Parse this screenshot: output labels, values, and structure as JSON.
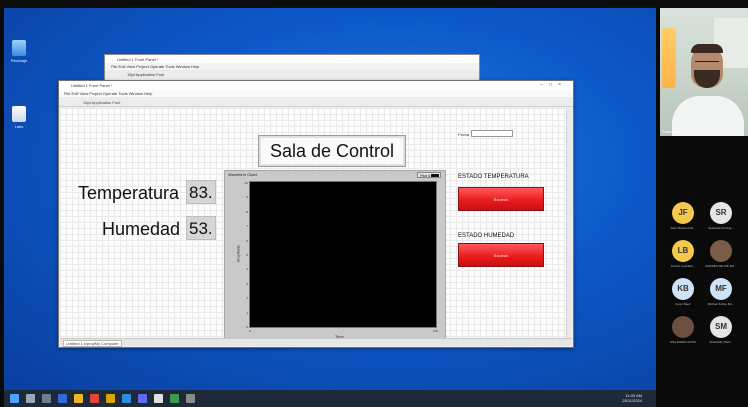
{
  "desktop": {
    "icons": [
      {
        "label": "Reciclaje"
      },
      {
        "label": "Labs"
      }
    ]
  },
  "back_window": {
    "title": "Untitled 1 Front Panel *",
    "menu": "File  Edit  View  Project  Operate  Tools  Window  Help",
    "toolbar": "15pt Application Font"
  },
  "front_window": {
    "title": "Untitled 1 Front Panel *",
    "menu": "File  Edit  View  Project  Operate  Tools  Window  Help",
    "toolbar": "15pt Application Font",
    "status": "Untitled 1.lvproj/My Computer"
  },
  "panel": {
    "title": "Sala de Control",
    "fecha_label": "Fecha",
    "temperatura_label": "Temperatura",
    "temperatura_value": "83.",
    "humedad_label": "Humedad",
    "humedad_value": "53.",
    "chart": {
      "title": "Waveform Chart",
      "legend": "Plot 0",
      "ylabel": "Amplitude",
      "xlabel": "Time"
    },
    "estado_temperatura_label": "ESTADO TEMPERATURA",
    "estado_temperatura_led": "Boolean",
    "estado_humedad_label": "ESTADO HUMEDAD",
    "estado_humedad_led": "Boolean"
  },
  "chart_data": {
    "type": "line",
    "series": [],
    "y_ticks": [
      "10",
      "9",
      "8",
      "7",
      "6",
      "5",
      "4",
      "3",
      "2",
      "1",
      "0"
    ],
    "x_ticks": [
      "0",
      "100"
    ]
  },
  "taskbar": {
    "clock_time": "11:00 AM",
    "clock_date": "28/11/2024"
  },
  "participants": {
    "video_name": "Participant",
    "avatars": [
      {
        "initials": "JF",
        "color": "#f2c94c",
        "name": "Juan Manuel Flor..."
      },
      {
        "initials": "SR",
        "color": "#e5e5e5",
        "name": "Sebastián Rodrig..."
      },
      {
        "initials": "LB",
        "color": "#f2c94c",
        "name": "Andrés Leal Berl..."
      },
      {
        "initials": "",
        "color": "#7a5c48",
        "name": "ANDRÉS FELIPE RO..."
      },
      {
        "initials": "KB",
        "color": "#cfe3f7",
        "name": "Kevin Baez"
      },
      {
        "initials": "MF",
        "color": "#cfe3f7",
        "name": "Michael Felipe Flo..."
      },
      {
        "initials": "",
        "color": "#6b5040",
        "name": "ANA MARÍA ORTIZ"
      },
      {
        "initials": "SM",
        "color": "#e5e5e5",
        "name": "Sebastián Marti..."
      }
    ]
  }
}
